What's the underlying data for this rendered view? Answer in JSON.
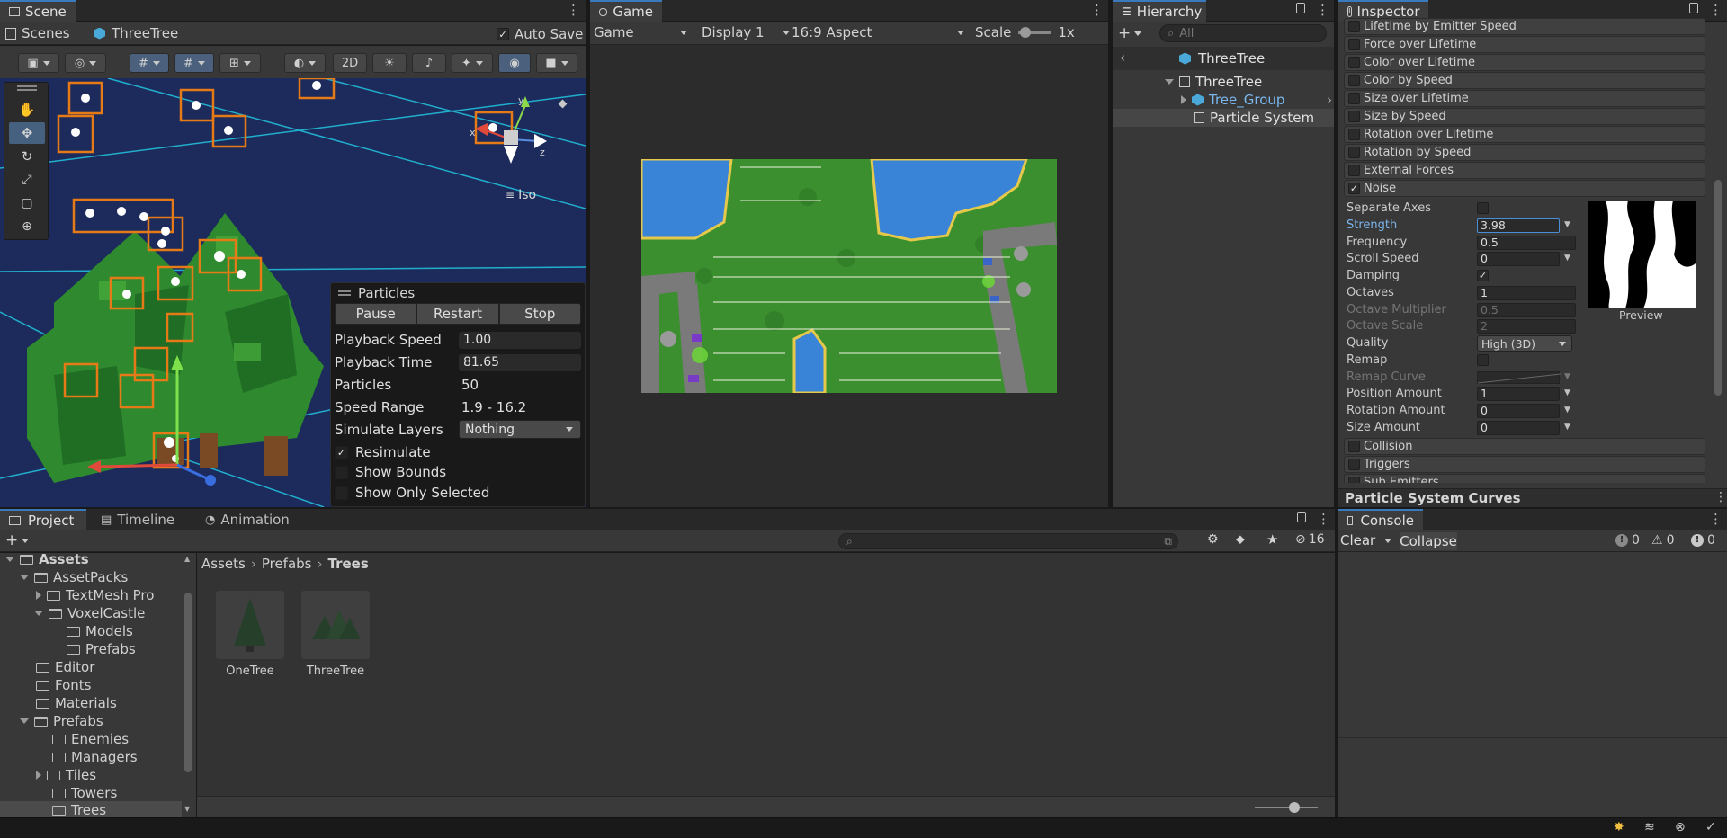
{
  "scene": {
    "tab_label": "Scene",
    "scenes_label": "Scenes",
    "scene_name": "ThreeTree",
    "auto_save_label": "Auto Save",
    "auto_save_checked": true,
    "btn_2d": "2D",
    "iso_label": "Iso",
    "gizmo_y": "y",
    "gizmo_x": "x",
    "gizmo_z": "z"
  },
  "particles_overlay": {
    "title": "Particles",
    "buttons": [
      "Pause",
      "Restart",
      "Stop"
    ],
    "rows": [
      {
        "label": "Playback Speed",
        "value": "1.00"
      },
      {
        "label": "Playback Time",
        "value": "81.65"
      },
      {
        "label": "Particles",
        "value": "50"
      },
      {
        "label": "Speed Range",
        "value": "1.9 - 16.2"
      },
      {
        "label": "Simulate Layers",
        "value": "Nothing"
      }
    ],
    "checks": [
      {
        "label": "Resimulate",
        "checked": true
      },
      {
        "label": "Show Bounds",
        "checked": false
      },
      {
        "label": "Show Only Selected",
        "checked": false
      }
    ]
  },
  "game": {
    "tab_label": "Game",
    "mode": "Game",
    "display": "Display 1",
    "aspect": "16:9 Aspect",
    "scale_label": "Scale",
    "scale_value": "1x"
  },
  "hierarchy": {
    "tab_label": "Hierarchy",
    "search_placeholder": "All",
    "breadcrumb": "ThreeTree",
    "items": [
      {
        "label": "ThreeTree",
        "level": 0,
        "type": "gameobject"
      },
      {
        "label": "Tree_Group",
        "level": 1,
        "type": "prefab"
      },
      {
        "label": "Particle System",
        "level": 1,
        "type": "gameobject"
      }
    ]
  },
  "inspector": {
    "tab_label": "Inspector",
    "modules": [
      {
        "label": "Lifetime by Emitter Speed",
        "checked": false
      },
      {
        "label": "Force over Lifetime",
        "checked": false
      },
      {
        "label": "Color over Lifetime",
        "checked": false
      },
      {
        "label": "Color by Speed",
        "checked": false
      },
      {
        "label": "Size over Lifetime",
        "checked": false
      },
      {
        "label": "Size by Speed",
        "checked": false
      },
      {
        "label": "Rotation over Lifetime",
        "checked": false
      },
      {
        "label": "Rotation by Speed",
        "checked": false
      },
      {
        "label": "External Forces",
        "checked": false
      },
      {
        "label": "Noise",
        "checked": true
      }
    ],
    "noise_props": [
      {
        "label": "Separate Axes",
        "kind": "check",
        "checked": false
      },
      {
        "label": "Strength",
        "kind": "field",
        "value": "3.98",
        "highlight": true,
        "dropdown": true
      },
      {
        "label": "Frequency",
        "kind": "field",
        "value": "0.5"
      },
      {
        "label": "Scroll Speed",
        "kind": "field",
        "value": "0",
        "dropdown": true
      },
      {
        "label": "Damping",
        "kind": "check",
        "checked": true
      },
      {
        "label": "Octaves",
        "kind": "field",
        "value": "1"
      },
      {
        "label": "Octave Multiplier",
        "kind": "field",
        "value": "0.5",
        "disabled": true
      },
      {
        "label": "Octave Scale",
        "kind": "field",
        "value": "2",
        "disabled": true
      },
      {
        "label": "Quality",
        "kind": "select",
        "value": "High (3D)"
      },
      {
        "label": "Remap",
        "kind": "check",
        "checked": false
      },
      {
        "label": "Remap Curve",
        "kind": "curve",
        "disabled": true,
        "dropdown": true
      },
      {
        "label": "Position Amount",
        "kind": "field",
        "value": "1",
        "dropdown": true
      },
      {
        "label": "Rotation Amount",
        "kind": "field",
        "value": "0",
        "dropdown": true
      },
      {
        "label": "Size Amount",
        "kind": "field",
        "value": "0",
        "dropdown": true
      }
    ],
    "preview_label": "Preview",
    "modules_after": [
      {
        "label": "Collision",
        "checked": false
      },
      {
        "label": "Triggers",
        "checked": false
      },
      {
        "label": "Sub Emitters",
        "checked": false
      }
    ],
    "curves_title": "Particle System Curves"
  },
  "project": {
    "tabs": [
      "Project",
      "Timeline",
      "Animation"
    ],
    "hidden_count": "16",
    "breadcrumb": [
      "Assets",
      "Prefabs",
      "Trees"
    ],
    "tree": [
      {
        "label": "Assets",
        "level": 0,
        "expand": "down",
        "bold": true
      },
      {
        "label": "AssetPacks",
        "level": 1,
        "expand": "down"
      },
      {
        "label": "TextMesh Pro",
        "level": 2,
        "expand": "right"
      },
      {
        "label": "VoxelCastle",
        "level": 2,
        "expand": "down"
      },
      {
        "label": "Models",
        "level": 3,
        "expand": "none"
      },
      {
        "label": "Prefabs",
        "level": 3,
        "expand": "none"
      },
      {
        "label": "Editor",
        "level": 1,
        "expand": "none"
      },
      {
        "label": "Fonts",
        "level": 1,
        "expand": "none"
      },
      {
        "label": "Materials",
        "level": 1,
        "expand": "none"
      },
      {
        "label": "Prefabs",
        "level": 1,
        "expand": "down"
      },
      {
        "label": "Enemies",
        "level": 2,
        "expand": "none"
      },
      {
        "label": "Managers",
        "level": 2,
        "expand": "none"
      },
      {
        "label": "Tiles",
        "level": 2,
        "expand": "right"
      },
      {
        "label": "Towers",
        "level": 2,
        "expand": "none"
      },
      {
        "label": "Trees",
        "level": 2,
        "expand": "none",
        "selected": true
      }
    ],
    "assets": [
      {
        "label": "OneTree"
      },
      {
        "label": "ThreeTree"
      }
    ]
  },
  "console": {
    "tab_label": "Console",
    "clear_label": "Clear",
    "collapse_label": "Collapse",
    "info_count": "0",
    "warn_count": "0",
    "error_count": "0"
  }
}
